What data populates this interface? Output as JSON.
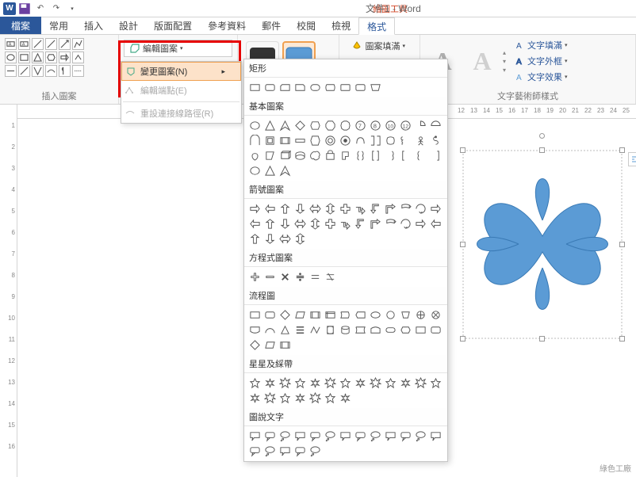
{
  "titlebar": {
    "tool_context": "繪圖工具",
    "doc_title": "文件1 - Word"
  },
  "tabs": {
    "file": "檔案",
    "items": [
      "常用",
      "插入",
      "設計",
      "版面配置",
      "參考資料",
      "郵件",
      "校閱",
      "檢視",
      "格式"
    ],
    "active_index": 8
  },
  "ribbon": {
    "group_insert_shape": "插入圖案",
    "group_shape_styles": "",
    "group_wordart": "文字藝術師樣式",
    "edit_shape_btn": "編輯圖案",
    "fill_label": "圖案填滿",
    "text_fill": "文字填滿",
    "text_outline": "文字外框",
    "text_effects": "文字效果"
  },
  "edit_menu": {
    "change_shape": "變更圖案(N)",
    "edit_points": "編輯端點(E)",
    "reroute": "重設連接線路徑(R)"
  },
  "shapes_flyout": {
    "categories": [
      "矩形",
      "基本圖案",
      "箭號圖案",
      "方程式圖案",
      "流程圖",
      "星星及綵帶",
      "圖說文字"
    ]
  },
  "hruler_ticks": [
    "12",
    "13",
    "14",
    "15",
    "16",
    "17",
    "18",
    "19",
    "20",
    "21",
    "22",
    "23",
    "24",
    "25"
  ],
  "vruler_ticks": [
    "1",
    "2",
    "3",
    "4",
    "5",
    "6",
    "7",
    "8",
    "9",
    "10",
    "11",
    "12",
    "13",
    "14",
    "15",
    "16"
  ],
  "page_corner": "L",
  "watermark": "綠色工廠"
}
